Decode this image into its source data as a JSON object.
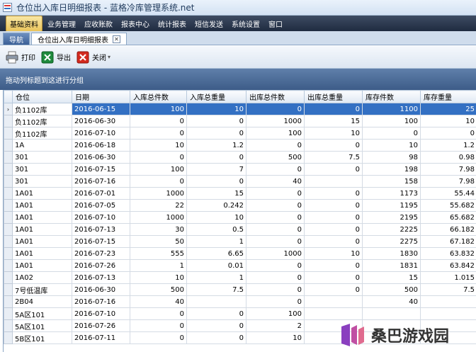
{
  "window": {
    "title": "仓位出入库日明细报表 - 蓝格冷库管理系统.net"
  },
  "menu": [
    "基础资料",
    "业务管理",
    "应收账款",
    "报表中心",
    "统计报表",
    "短信发送",
    "系统设置",
    "窗口"
  ],
  "tabs": {
    "nav": "导航",
    "current": "仓位出入库日明细报表"
  },
  "toolbar": {
    "print": "打印",
    "export": "导出",
    "close": "关闭"
  },
  "group_hint": "拖动列标题到这进行分组",
  "table": {
    "columns": [
      "仓位",
      "日期",
      "入库总件数",
      "入库总重量",
      "出库总件数",
      "出库总重量",
      "库存件数",
      "库存重量"
    ],
    "rows": [
      [
        "负1102库",
        "2016-06-15",
        "100",
        "10",
        "0",
        "0",
        "1100",
        "25"
      ],
      [
        "负1102库",
        "2016-06-30",
        "0",
        "0",
        "1000",
        "15",
        "100",
        "10"
      ],
      [
        "负1102库",
        "2016-07-10",
        "0",
        "0",
        "100",
        "10",
        "0",
        "0"
      ],
      [
        "1A",
        "2016-06-18",
        "10",
        "1.2",
        "0",
        "0",
        "10",
        "1.2"
      ],
      [
        "301",
        "2016-06-30",
        "0",
        "0",
        "500",
        "7.5",
        "98",
        "0.98"
      ],
      [
        "301",
        "2016-07-15",
        "100",
        "7",
        "0",
        "0",
        "198",
        "7.98"
      ],
      [
        "301",
        "2016-07-16",
        "0",
        "0",
        "40",
        "",
        "158",
        "7.98"
      ],
      [
        "1A01",
        "2016-07-01",
        "1000",
        "15",
        "0",
        "0",
        "1173",
        "55.44"
      ],
      [
        "1A01",
        "2016-07-05",
        "22",
        "0.242",
        "0",
        "0",
        "1195",
        "55.682"
      ],
      [
        "1A01",
        "2016-07-10",
        "1000",
        "10",
        "0",
        "0",
        "2195",
        "65.682"
      ],
      [
        "1A01",
        "2016-07-13",
        "30",
        "0.5",
        "0",
        "0",
        "2225",
        "66.182"
      ],
      [
        "1A01",
        "2016-07-15",
        "50",
        "1",
        "0",
        "0",
        "2275",
        "67.182"
      ],
      [
        "1A01",
        "2016-07-23",
        "555",
        "6.65",
        "1000",
        "10",
        "1830",
        "63.832"
      ],
      [
        "1A01",
        "2016-07-26",
        "1",
        "0.01",
        "0",
        "0",
        "1831",
        "63.842"
      ],
      [
        "1A02",
        "2016-07-13",
        "10",
        "1",
        "0",
        "0",
        "15",
        "1.015"
      ],
      [
        "7号低温库",
        "2016-06-30",
        "500",
        "7.5",
        "0",
        "0",
        "500",
        "7.5"
      ],
      [
        "2B04",
        "2016-07-16",
        "40",
        "",
        "0",
        "",
        "40",
        ""
      ],
      [
        "5A区101",
        "2016-07-10",
        "0",
        "0",
        "100",
        "",
        "",
        ""
      ],
      [
        "5A区101",
        "2016-07-26",
        "0",
        "0",
        "2",
        "",
        "",
        ""
      ],
      [
        "5B区101",
        "2016-07-11",
        "0",
        "0",
        "10",
        "",
        "",
        ""
      ]
    ]
  },
  "watermark": {
    "text": "桑巴游戏园"
  }
}
